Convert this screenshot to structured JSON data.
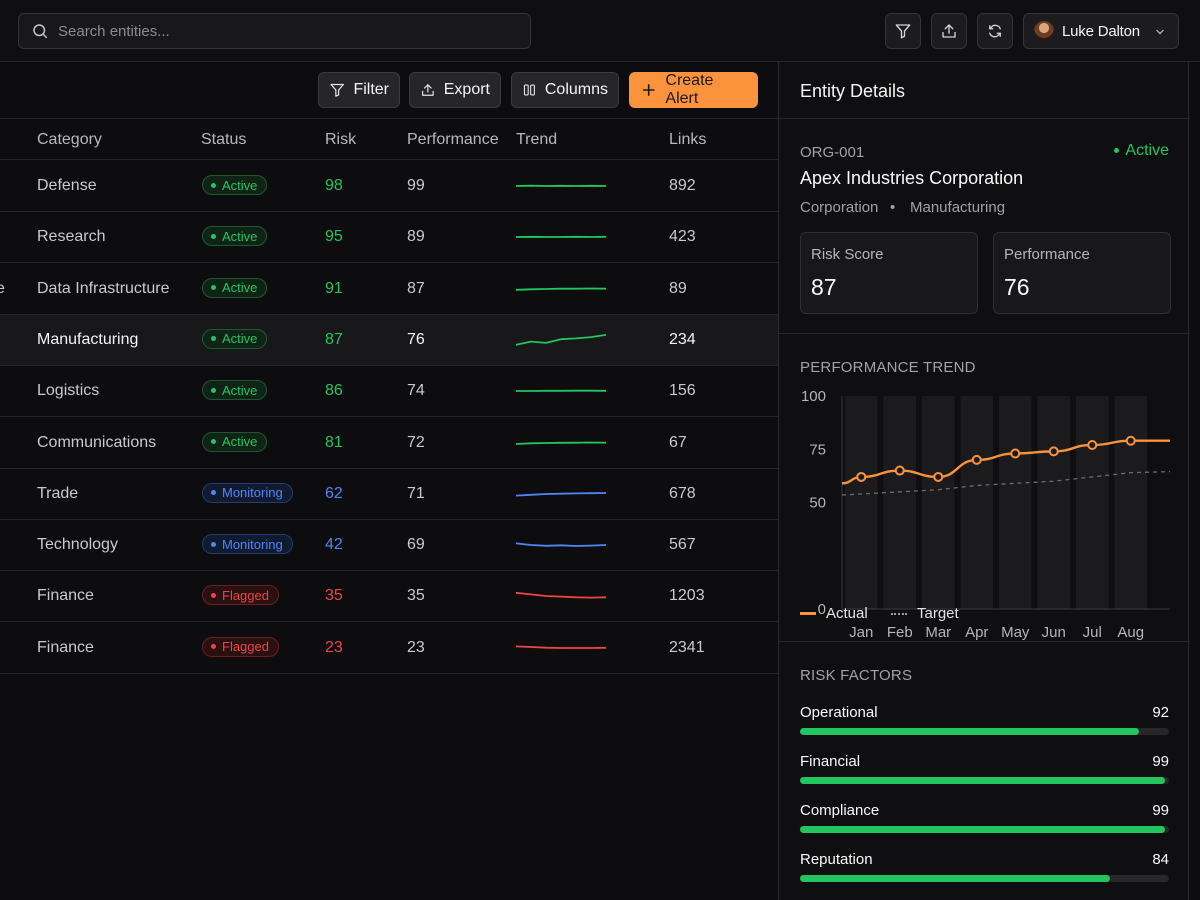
{
  "search": {
    "placeholder": "Search entities..."
  },
  "user": {
    "name": "Luke Dalton"
  },
  "toolbar": {
    "filter": "Filter",
    "export": "Export",
    "columns": "Columns",
    "create_alert": "Create Alert"
  },
  "table": {
    "headers": {
      "category": "Category",
      "status": "Status",
      "risk": "Risk",
      "performance": "Performance",
      "trend": "Trend",
      "links": "Links"
    },
    "rows": [
      {
        "edge": "",
        "category": "Defense",
        "status": "Active",
        "risk": "98",
        "performance": "99",
        "links": "892",
        "trend": [
          0.5,
          0.48,
          0.5,
          0.49,
          0.5,
          0.49,
          0.5
        ]
      },
      {
        "edge": "",
        "category": "Research",
        "status": "Active",
        "risk": "95",
        "performance": "89",
        "links": "423",
        "trend": [
          0.5,
          0.49,
          0.5,
          0.5,
          0.49,
          0.5,
          0.49
        ]
      },
      {
        "edge": "e",
        "category": "Data Infrastructure",
        "status": "Active",
        "risk": "91",
        "performance": "87",
        "links": "89",
        "trend": [
          0.55,
          0.52,
          0.5,
          0.48,
          0.48,
          0.47,
          0.48
        ]
      },
      {
        "edge": "",
        "category": "Manufacturing",
        "status": "Active",
        "risk": "87",
        "performance": "76",
        "links": "234",
        "trend": [
          0.8,
          0.6,
          0.68,
          0.45,
          0.4,
          0.32,
          0.18
        ]
      },
      {
        "edge": "",
        "category": "Logistics",
        "status": "Active",
        "risk": "86",
        "performance": "74",
        "links": "156",
        "trend": [
          0.5,
          0.5,
          0.49,
          0.49,
          0.48,
          0.48,
          0.49
        ]
      },
      {
        "edge": "",
        "category": "Communications",
        "status": "Active",
        "risk": "81",
        "performance": "72",
        "links": "67",
        "trend": [
          0.56,
          0.52,
          0.5,
          0.49,
          0.48,
          0.47,
          0.48
        ]
      },
      {
        "edge": "",
        "category": "Trade",
        "status": "Monitoring",
        "risk": "62",
        "performance": "71",
        "links": "678",
        "trend": [
          0.6,
          0.55,
          0.5,
          0.48,
          0.46,
          0.45,
          0.44
        ]
      },
      {
        "edge": "",
        "category": "Technology",
        "status": "Monitoring",
        "risk": "42",
        "performance": "69",
        "links": "567",
        "trend": [
          0.4,
          0.5,
          0.55,
          0.52,
          0.56,
          0.54,
          0.5
        ]
      },
      {
        "edge": "",
        "category": "Finance",
        "status": "Flagged",
        "risk": "35",
        "performance": "35",
        "links": "1203",
        "trend": [
          0.3,
          0.4,
          0.5,
          0.54,
          0.58,
          0.6,
          0.58
        ]
      },
      {
        "edge": "",
        "category": "Finance",
        "status": "Flagged",
        "risk": "23",
        "performance": "23",
        "links": "2341",
        "trend": [
          0.4,
          0.44,
          0.48,
          0.5,
          0.5,
          0.5,
          0.49
        ]
      }
    ]
  },
  "panel": {
    "title": "Entity Details",
    "entity": {
      "id": "ORG-001",
      "status": "Active",
      "name": "Apex Industries Corporation",
      "type": "Corporation",
      "separator": "•",
      "industry": "Manufacturing"
    },
    "stats": {
      "risk_label": "Risk Score",
      "risk_value": "87",
      "perf_label": "Performance",
      "perf_value": "76"
    },
    "trend_title": "PERFORMANCE TREND",
    "legend": {
      "actual": "Actual",
      "target": "Target"
    },
    "risk_title": "RISK FACTORS",
    "risk_factors": [
      {
        "label": "Operational",
        "value": 92
      },
      {
        "label": "Financial",
        "value": 99
      },
      {
        "label": "Compliance",
        "value": 99
      },
      {
        "label": "Reputation",
        "value": 84
      }
    ]
  },
  "colors": {
    "accent": "#fb923c",
    "active": "#22c55e",
    "monitoring": "#4f86f7",
    "flagged": "#ef4444"
  },
  "chart_data": {
    "type": "line",
    "title": "PERFORMANCE TREND",
    "categories": [
      "Jan",
      "Feb",
      "Mar",
      "Apr",
      "May",
      "Jun",
      "Jul",
      "Aug"
    ],
    "y_ticks": [
      "0",
      "50",
      "75",
      "100"
    ],
    "ylim": [
      0,
      100
    ],
    "series": [
      {
        "name": "Actual",
        "values": [
          62,
          65,
          62,
          70,
          73,
          74,
          77,
          79
        ],
        "style": "solid",
        "color": "#fb923c"
      },
      {
        "name": "Target",
        "values": [
          54,
          55,
          56,
          58,
          59,
          60,
          62,
          64
        ],
        "style": "dashed",
        "color": "#71717a"
      }
    ],
    "bar_background": true,
    "legend": "bottom-left"
  }
}
